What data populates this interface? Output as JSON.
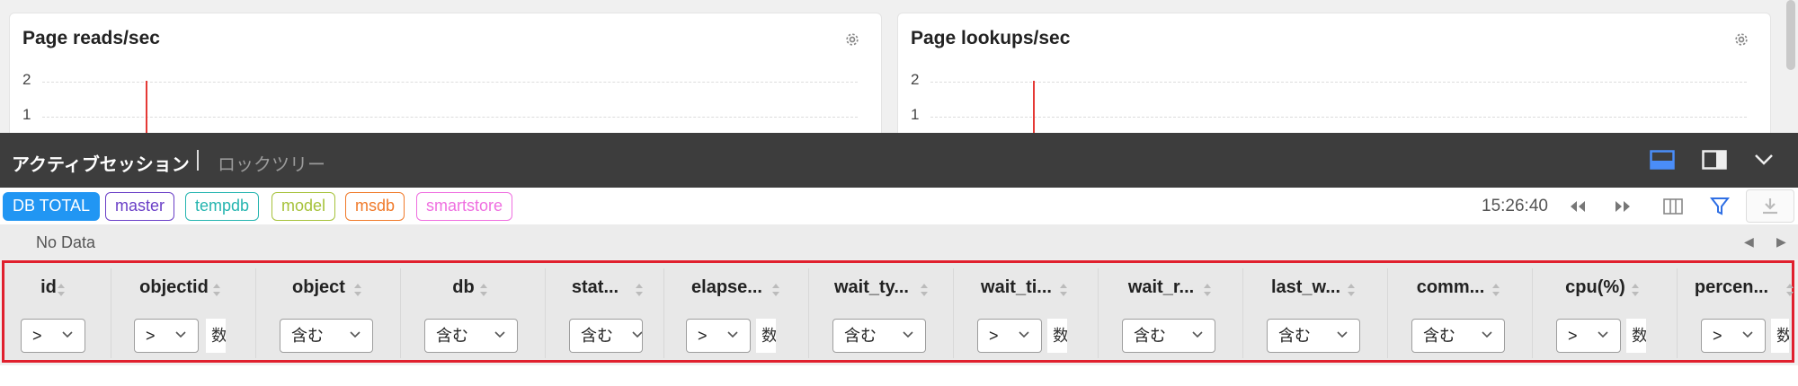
{
  "cards": [
    {
      "title": "Page reads/sec",
      "y_ticks": [
        "2",
        "1"
      ]
    },
    {
      "title": "Page lookups/sec",
      "y_ticks": [
        "2",
        "1"
      ]
    }
  ],
  "panel": {
    "tabs": [
      {
        "label": "アクティブセッション",
        "active": true
      },
      {
        "label": "ロックツリー",
        "active": false
      }
    ]
  },
  "db_filters": [
    {
      "label": "DB TOTAL",
      "color": "#2196f3",
      "active": true
    },
    {
      "label": "master",
      "color": "#6a3fc7",
      "active": false
    },
    {
      "label": "tempdb",
      "color": "#26b5b0",
      "active": false
    },
    {
      "label": "model",
      "color": "#a6c23a",
      "active": false
    },
    {
      "label": "msdb",
      "color": "#f07a2a",
      "active": false
    },
    {
      "label": "smartstore",
      "color": "#ef6fe0",
      "active": false
    }
  ],
  "toolbar": {
    "time": "15:26:40"
  },
  "status": {
    "no_data": "No Data"
  },
  "columns": [
    {
      "title": "id",
      "operator": ">",
      "input": ""
    },
    {
      "title": "objectid",
      "operator": ">",
      "input": "数字"
    },
    {
      "title": "object",
      "operator": "含む",
      "input": ""
    },
    {
      "title": "db",
      "operator": "含む",
      "input": ""
    },
    {
      "title": "stat...",
      "operator": "含む",
      "input": ""
    },
    {
      "title": "elapse...",
      "operator": ">",
      "input": "数字"
    },
    {
      "title": "wait_ty...",
      "operator": "含む",
      "input": ""
    },
    {
      "title": "wait_ti...",
      "operator": ">",
      "input": "数字"
    },
    {
      "title": "wait_r...",
      "operator": "含む",
      "input": ""
    },
    {
      "title": "last_w...",
      "operator": "含む",
      "input": ""
    },
    {
      "title": "comm...",
      "operator": "含む",
      "input": ""
    },
    {
      "title": "cpu(%)",
      "operator": ">",
      "input": "数字"
    },
    {
      "title": "percen...",
      "operator": ">",
      "input": "数字"
    }
  ],
  "icons": {
    "settings": "gear-icon",
    "layout_bottom": "layout-bottom-icon",
    "layout_side": "layout-side-icon",
    "collapse": "chevron-down-icon",
    "rewind": "rewind-icon",
    "forward": "fast-forward-icon",
    "columns": "columns-icon",
    "filter": "filter-icon",
    "download": "download-icon"
  }
}
